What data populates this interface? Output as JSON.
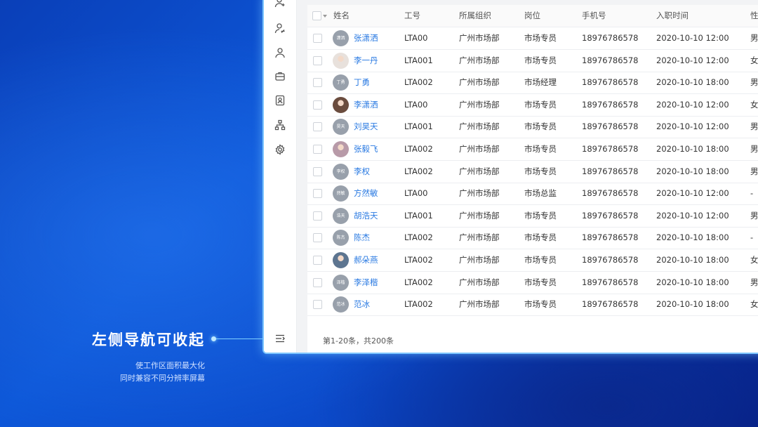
{
  "annotation": {
    "title": "左侧导航可收起",
    "line1": "使工作区面积最大化",
    "line2": "同时兼容不同分辨率屏幕"
  },
  "sidebar_icons": [
    "add-user-icon",
    "user-edit-icon",
    "user-icon",
    "briefcase-icon",
    "id-card-icon",
    "org-chart-icon",
    "gear-icon",
    "collapse-menu-icon"
  ],
  "table": {
    "columns": [
      "姓名",
      "工号",
      "所属组织",
      "岗位",
      "手机号",
      "入职时间",
      "性"
    ],
    "rows": [
      {
        "avatar": "潇洒",
        "photo": false,
        "name": "张潇洒",
        "id": "LTA00",
        "org": "广州市场部",
        "post": "市场专员",
        "phone": "18976786578",
        "date": "2020-10-10  12:00",
        "gender": "男"
      },
      {
        "avatar": "",
        "photo": true,
        "photo_color": "#e8e1dc",
        "name": "李一丹",
        "id": "LTA001",
        "org": "广州市场部",
        "post": "市场专员",
        "phone": "18976786578",
        "date": "2020-10-10  12:00",
        "gender": "女"
      },
      {
        "avatar": "丁勇",
        "photo": false,
        "name": "丁勇",
        "id": "LTA002",
        "org": "广州市场部",
        "post": "市场经理",
        "phone": "18976786578",
        "date": "2020-10-10  18:00",
        "gender": "男"
      },
      {
        "avatar": "",
        "photo": true,
        "photo_color": "#6a4c3e",
        "name": "李潇洒",
        "id": "LTA00",
        "org": "广州市场部",
        "post": "市场专员",
        "phone": "18976786578",
        "date": "2020-10-10  12:00",
        "gender": "女"
      },
      {
        "avatar": "昊天",
        "photo": false,
        "name": "刘昊天",
        "id": "LTA001",
        "org": "广州市场部",
        "post": "市场专员",
        "phone": "18976786578",
        "date": "2020-10-10  12:00",
        "gender": "男"
      },
      {
        "avatar": "",
        "photo": true,
        "photo_color": "#b89aa8",
        "name": "张毅飞",
        "id": "LTA002",
        "org": "广州市场部",
        "post": "市场专员",
        "phone": "18976786578",
        "date": "2020-10-10  18:00",
        "gender": "男"
      },
      {
        "avatar": "李权",
        "photo": false,
        "name": "李权",
        "id": "LTA002",
        "org": "广州市场部",
        "post": "市场专员",
        "phone": "18976786578",
        "date": "2020-10-10  18:00",
        "gender": "男"
      },
      {
        "avatar": "然敏",
        "photo": false,
        "name": "方然敏",
        "id": "LTA00",
        "org": "广州市场部",
        "post": "市场总监",
        "phone": "18976786578",
        "date": "2020-10-10  12:00",
        "gender": "-"
      },
      {
        "avatar": "浩天",
        "photo": false,
        "name": "胡浩天",
        "id": "LTA001",
        "org": "广州市场部",
        "post": "市场专员",
        "phone": "18976786578",
        "date": "2020-10-10  12:00",
        "gender": "男"
      },
      {
        "avatar": "陈杰",
        "photo": false,
        "name": "陈杰",
        "id": "LTA002",
        "org": "广州市场部",
        "post": "市场专员",
        "phone": "18976786578",
        "date": "2020-10-10  18:00",
        "gender": "-"
      },
      {
        "avatar": "",
        "photo": true,
        "photo_color": "#5d7590",
        "name": "郝朵燕",
        "id": "LTA002",
        "org": "广州市场部",
        "post": "市场专员",
        "phone": "18976786578",
        "date": "2020-10-10  18:00",
        "gender": "女"
      },
      {
        "avatar": "泽楷",
        "photo": false,
        "name": "李泽楷",
        "id": "LTA002",
        "org": "广州市场部",
        "post": "市场专员",
        "phone": "18976786578",
        "date": "2020-10-10  18:00",
        "gender": "男"
      },
      {
        "avatar": "范冰",
        "photo": false,
        "name": "范冰",
        "id": "LTA002",
        "org": "广州市场部",
        "post": "市场专员",
        "phone": "18976786578",
        "date": "2020-10-10  18:00",
        "gender": "女"
      }
    ]
  },
  "footer": "第1-20条，共200条"
}
